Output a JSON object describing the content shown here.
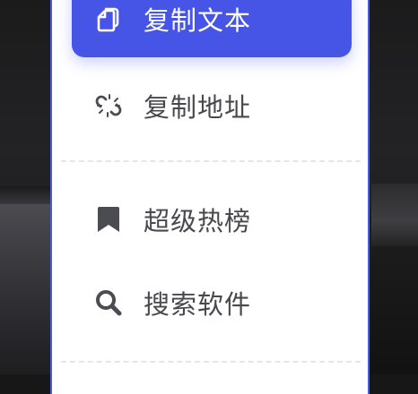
{
  "menu": {
    "items": [
      {
        "label": "复制文本",
        "icon": "copy-icon",
        "active": true
      },
      {
        "label": "复制地址",
        "icon": "broken-link-icon",
        "active": false
      },
      {
        "label": "超级热榜",
        "icon": "bookmark-icon",
        "active": false
      },
      {
        "label": "搜索软件",
        "icon": "search-icon",
        "active": false
      }
    ]
  },
  "colors": {
    "accent": "#4755e6",
    "menu_border": "#4a5ae8",
    "text": "#48484f",
    "active_text": "#ffffff",
    "divider": "#e6e6ea",
    "background": "#171717"
  }
}
